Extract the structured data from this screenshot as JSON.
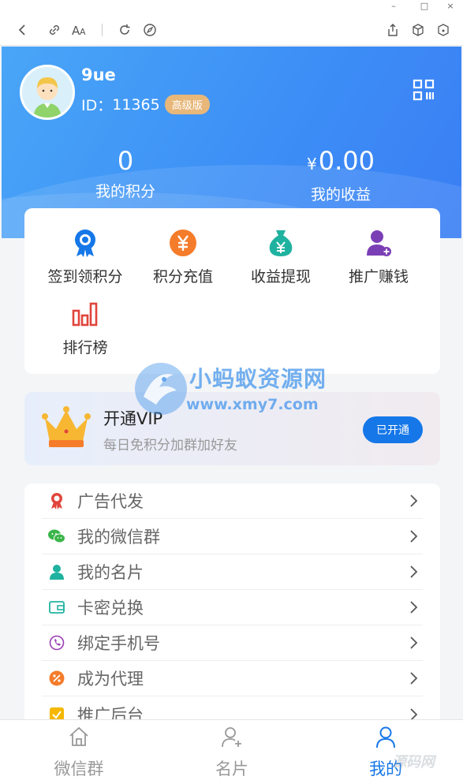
{
  "window": {
    "minimize": "–",
    "maximize": "□",
    "close": "×"
  },
  "profile": {
    "name": "9ue",
    "id_label": "ID：",
    "id_value": "11365",
    "level_badge": "高级版"
  },
  "stats": [
    {
      "value": "0",
      "label": "我的积分"
    },
    {
      "currency": "¥",
      "value": "0.00",
      "label": "我的收益"
    }
  ],
  "quick_actions": [
    {
      "label": "签到领积分",
      "icon": "medal-icon",
      "color": "#1677e8"
    },
    {
      "label": "积分充值",
      "icon": "yen-coin-icon",
      "color": "#f57c2a"
    },
    {
      "label": "收益提现",
      "icon": "money-bag-icon",
      "color": "#20b2a0"
    },
    {
      "label": "推广赚钱",
      "icon": "user-add-icon",
      "color": "#7b3fb5"
    },
    {
      "label": "排行榜",
      "icon": "bar-chart-icon",
      "color": "#e0453c"
    }
  ],
  "vip": {
    "title": "开通VIP",
    "subtitle": "每日免积分加群加好友",
    "button": "已开通"
  },
  "watermark": {
    "title": "小蚂蚁资源网",
    "url": "www.xmy7.com"
  },
  "menu": [
    {
      "label": "广告代发",
      "icon": "award-icon",
      "color": "#e0453c"
    },
    {
      "label": "我的微信群",
      "icon": "wechat-icon",
      "color": "#3bb54a"
    },
    {
      "label": "我的名片",
      "icon": "person-icon",
      "color": "#20b2a0"
    },
    {
      "label": "卡密兑换",
      "icon": "wallet-icon",
      "color": "#20b2a0"
    },
    {
      "label": "绑定手机号",
      "icon": "phone-icon",
      "color": "#9b3fb5"
    },
    {
      "label": "成为代理",
      "icon": "discount-icon",
      "color": "#f57c2a"
    },
    {
      "label": "推广后台",
      "icon": "checkbox-icon",
      "color": "#f5b800"
    }
  ],
  "tabs": [
    {
      "label": "微信群",
      "icon": "home-icon",
      "active": false
    },
    {
      "label": "名片",
      "icon": "user-add-icon",
      "active": false
    },
    {
      "label": "我的",
      "icon": "user-icon",
      "active": true
    }
  ],
  "corner_watermark": "源码网",
  "colors": {
    "primary": "#1677e8",
    "header_start": "#49a6f7",
    "header_end": "#3a7ef4",
    "badge": "#e8b77a"
  }
}
